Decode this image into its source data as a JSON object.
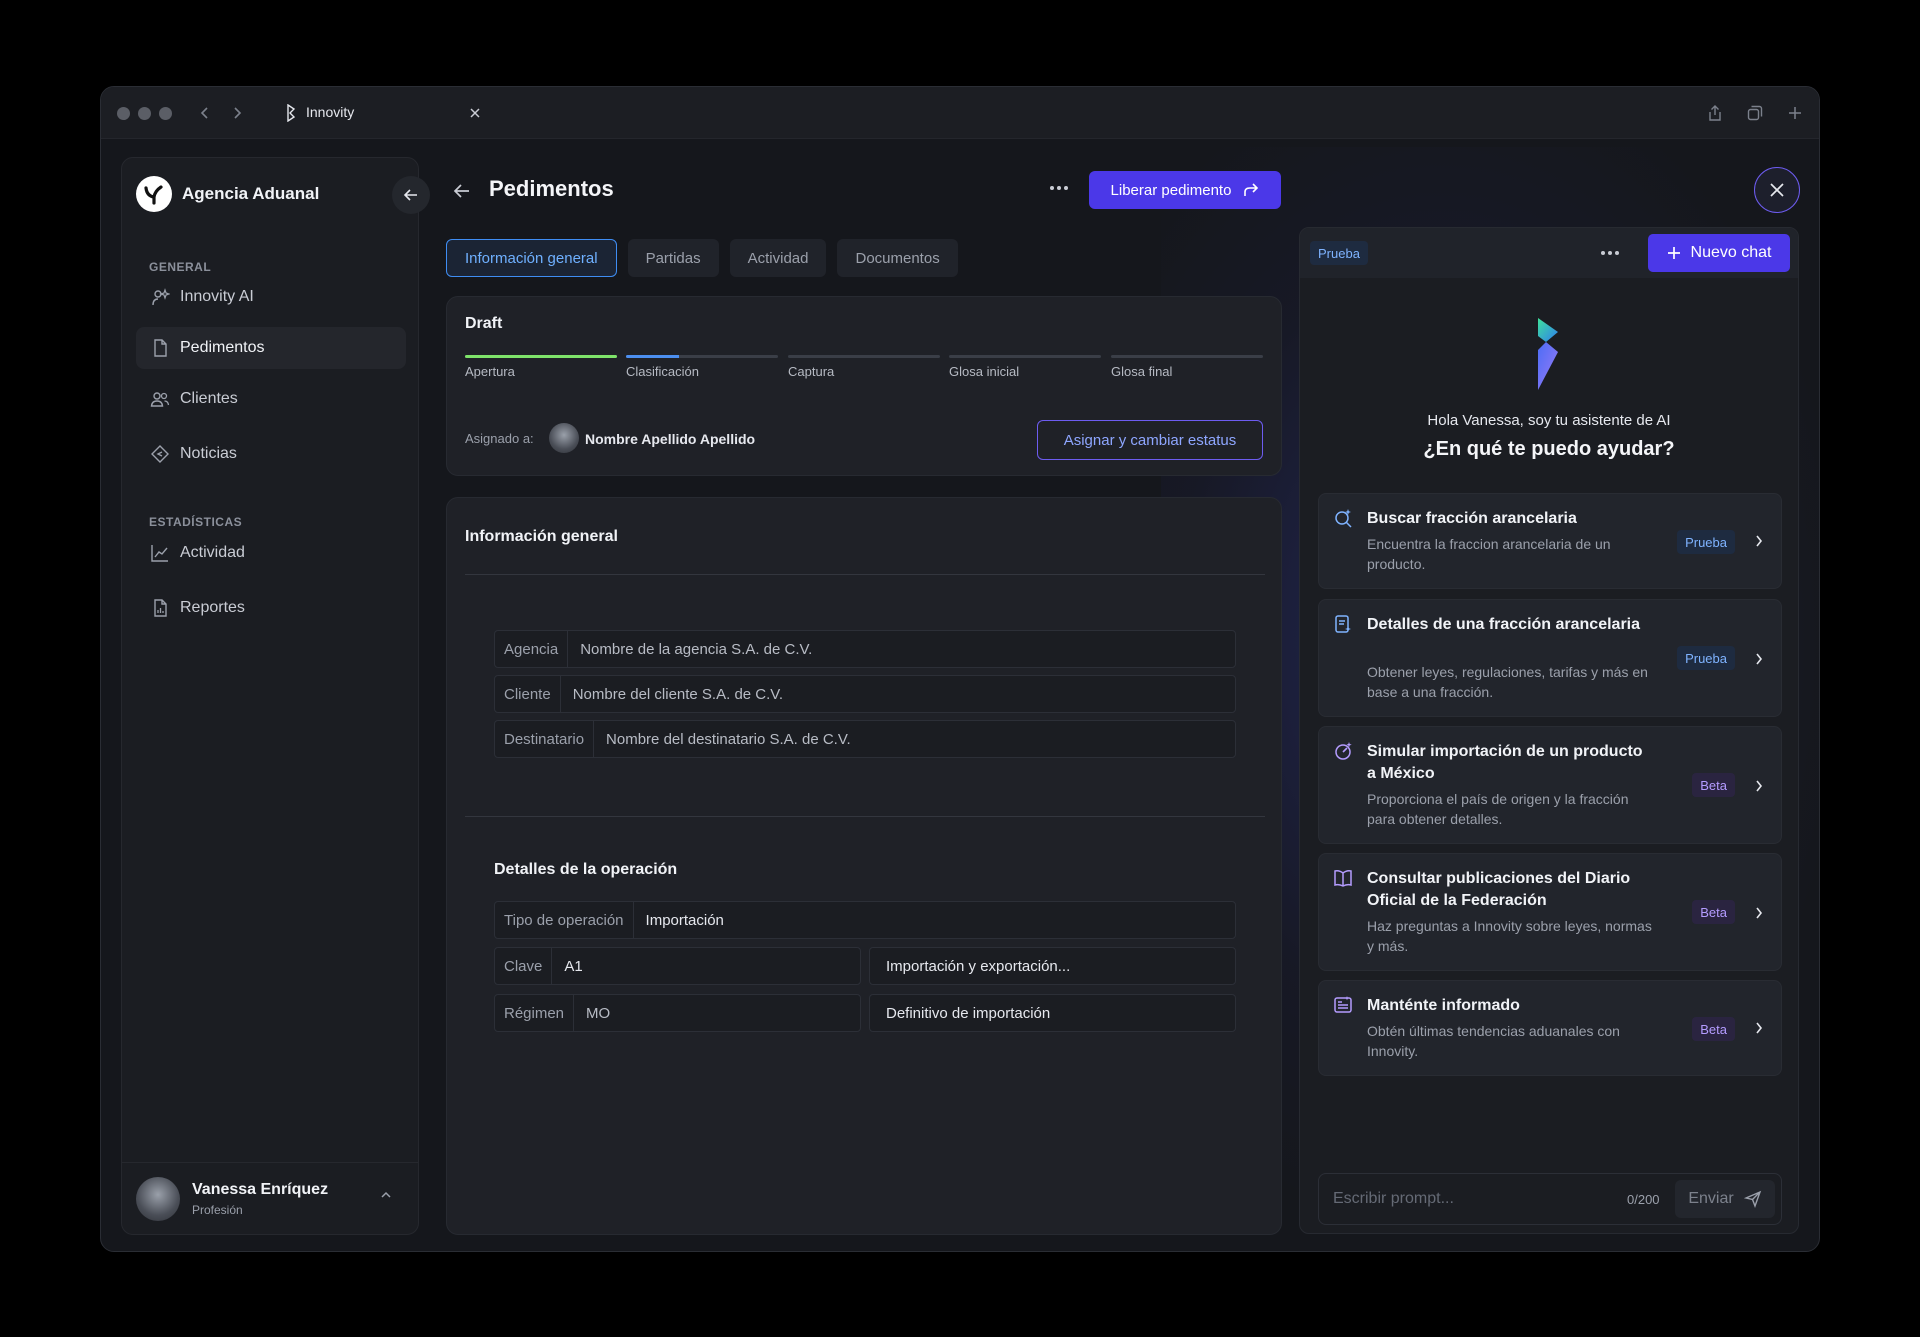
{
  "browser": {
    "tab_title": "Innovity"
  },
  "sidebar": {
    "brand": "Agencia Aduanal",
    "sections": [
      {
        "label": "GENERAL",
        "items": [
          {
            "label": "Innovity AI",
            "icon": "sparkle-user-icon"
          },
          {
            "label": "Pedimentos",
            "icon": "document-icon",
            "active": true
          },
          {
            "label": "Clientes",
            "icon": "users-icon"
          },
          {
            "label": "Noticias",
            "icon": "tag-icon"
          }
        ]
      },
      {
        "label": "ESTADÍSTICAS",
        "items": [
          {
            "label": "Actividad",
            "icon": "line-chart-icon"
          },
          {
            "label": "Reportes",
            "icon": "report-icon"
          }
        ]
      }
    ],
    "user": {
      "name": "Vanessa Enríquez",
      "role": "Profesión"
    }
  },
  "header": {
    "title": "Pedimentos",
    "primary_action": "Liberar pedimento"
  },
  "tabs": [
    "Información general",
    "Partidas",
    "Actividad",
    "Documentos"
  ],
  "status_card": {
    "status": "Draft",
    "steps": [
      {
        "label": "Apertura",
        "progress": 1.0,
        "color": "#7ee36a"
      },
      {
        "label": "Clasificación",
        "progress": 0.35,
        "color": "#4c8ff0"
      },
      {
        "label": "Captura",
        "progress": 0
      },
      {
        "label": "Glosa inicial",
        "progress": 0
      },
      {
        "label": "Glosa final",
        "progress": 0
      }
    ],
    "assigned_label": "Asignado a:",
    "assignee": "Nombre Apellido Apellido",
    "action": "Asignar y cambiar estatus"
  },
  "general_info": {
    "title": "Información general",
    "fields": [
      {
        "label": "Agencia",
        "value": "Nombre de la agencia S.A. de C.V."
      },
      {
        "label": "Cliente",
        "value": "Nombre del cliente S.A. de C.V."
      },
      {
        "label": "Destinatario",
        "value": "Nombre del destinatario S.A. de C.V."
      }
    ]
  },
  "operation": {
    "title": "Detalles de la operación",
    "tipo": {
      "label": "Tipo de operación",
      "value": "Importación"
    },
    "clave": {
      "label": "Clave",
      "value": "A1",
      "description": "Importación y exportación..."
    },
    "regimen": {
      "label": "Régimen",
      "value": "MO",
      "description": "Definitivo de importación"
    }
  },
  "ai_panel": {
    "badge": "Prueba",
    "new_chat": "Nuevo chat",
    "greeting": "Hola Vanessa, soy tu asistente de AI",
    "question": "¿En qué te puedo ayudar?",
    "cards": [
      {
        "title": "Buscar fracción arancelaria",
        "description": "Encuentra la fraccion arancelaria de un producto.",
        "badge": "Prueba",
        "icon": "search-sparkle-icon"
      },
      {
        "title": "Detalles de una fracción arancelaria",
        "description": "Obtener leyes, regulaciones, tarifas y más en base a una fracción.",
        "badge": "Prueba",
        "icon": "document-sparkle-icon"
      },
      {
        "title": "Simular importación de un producto a México",
        "description": "Proporciona el país de origen y la fracción para obtener detalles.",
        "badge": "Beta",
        "icon": "gauge-icon"
      },
      {
        "title": "Consultar publicaciones del Diario Oficial de la Federación",
        "description": "Haz preguntas a Innovity sobre leyes, normas y más.",
        "badge": "Beta",
        "icon": "book-icon"
      },
      {
        "title": "Manténte informado",
        "description": "Obtén últimas tendencias aduanales con Innovity.",
        "badge": "Beta",
        "icon": "news-icon"
      }
    ],
    "prompt_placeholder": "Escribir prompt...",
    "counter": "0/200",
    "send": "Enviar"
  }
}
